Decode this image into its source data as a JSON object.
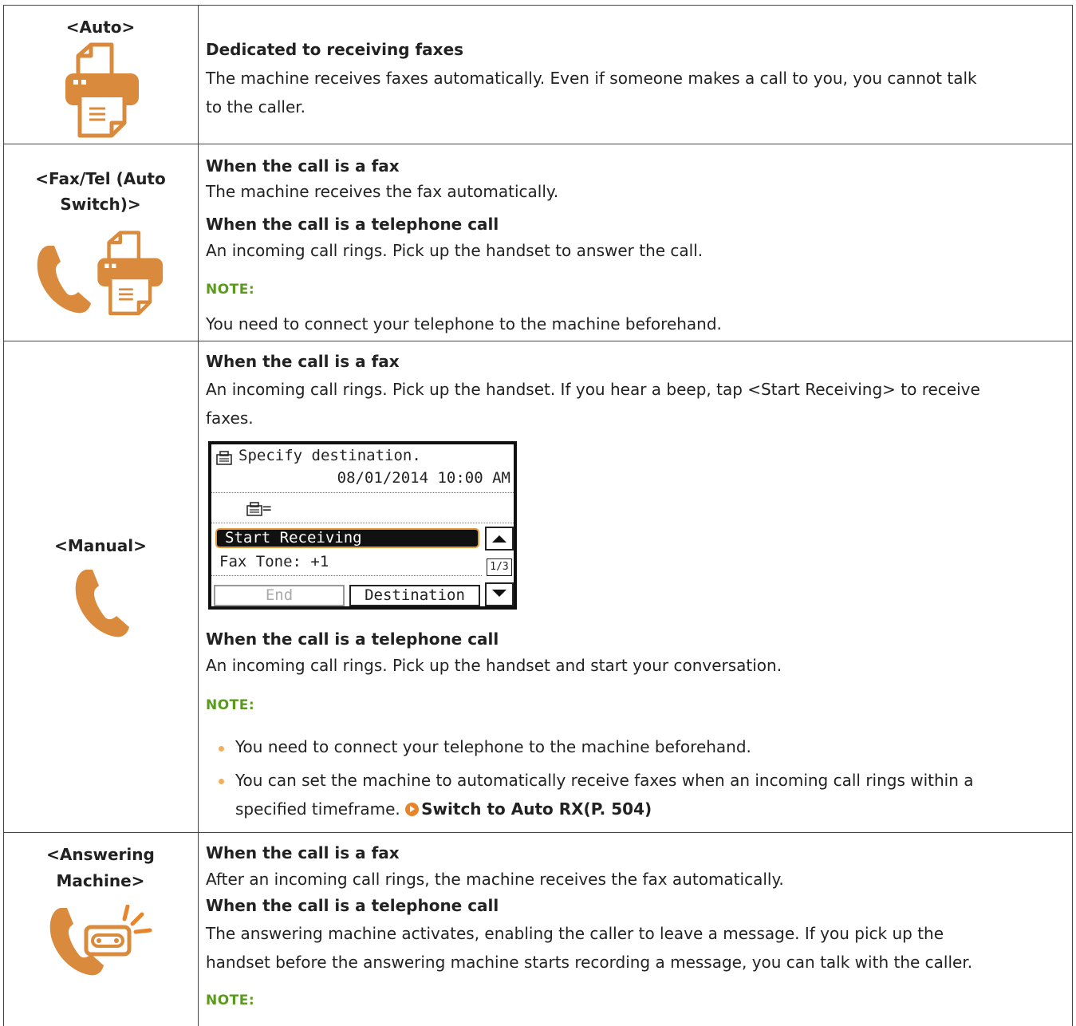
{
  "rows": [
    {
      "mode": "<Auto>",
      "heading": "Dedicated to receiving faxes",
      "text_line1": "The machine receives faxes automatically. Even if someone makes a call to you, you cannot talk",
      "text_line2": "to the caller."
    },
    {
      "mode_line1": "<Fax/Tel (Auto",
      "mode_line2": "Switch)>",
      "fax_heading": "When the call is a fax",
      "fax_text": "The machine receives the fax automatically.",
      "tel_heading": "When the call is a telephone call",
      "tel_text": "An incoming call rings. Pick up the handset to answer the call.",
      "note_label": "NOTE:",
      "note_text": "You need to connect your telephone to the machine beforehand."
    },
    {
      "mode": "<Manual>",
      "fax_heading": "When the call is a fax",
      "fax_text_line1": "An incoming call rings. Pick up the handset. If you hear a beep, tap <Start Receiving> to receive",
      "fax_text_line2": "faxes.",
      "tel_heading": "When the call is a telephone call",
      "tel_text": "An incoming call rings. Pick up the handset and start your conversation.",
      "note_label": "NOTE:",
      "bullet1": "You need to connect your telephone to the machine beforehand.",
      "bullet2_line1": "You can set the machine to automatically receive faxes when an incoming call rings within a",
      "bullet2_line2": "specified timeframe.",
      "link": "Switch to Auto RX(P. 504)"
    },
    {
      "mode_line1": "<Answering",
      "mode_line2": "Machine>",
      "fax_heading": "When the call is a fax",
      "fax_text": "After an incoming call rings, the machine receives the fax automatically.",
      "tel_heading": "When the call is a telephone call",
      "tel_text_line1": "The answering machine activates, enabling the caller to leave a message. If you pick up the",
      "tel_text_line2": "handset before the answering machine starts recording a message, you can talk with the caller.",
      "note_label": "NOTE:"
    }
  ],
  "lcd": {
    "title": "Specify destination.",
    "datetime": "08/01/2014 10:00 AM",
    "fax_field": "=",
    "selected_item": "Start Receiving",
    "item2": "Fax Tone: +1",
    "page": "1/3",
    "end_button": "End",
    "destination_button": "Destination"
  },
  "colors": {
    "icon": "#d98a3d",
    "note": "#5a9a1c",
    "link_arrow": "#e8852b"
  }
}
